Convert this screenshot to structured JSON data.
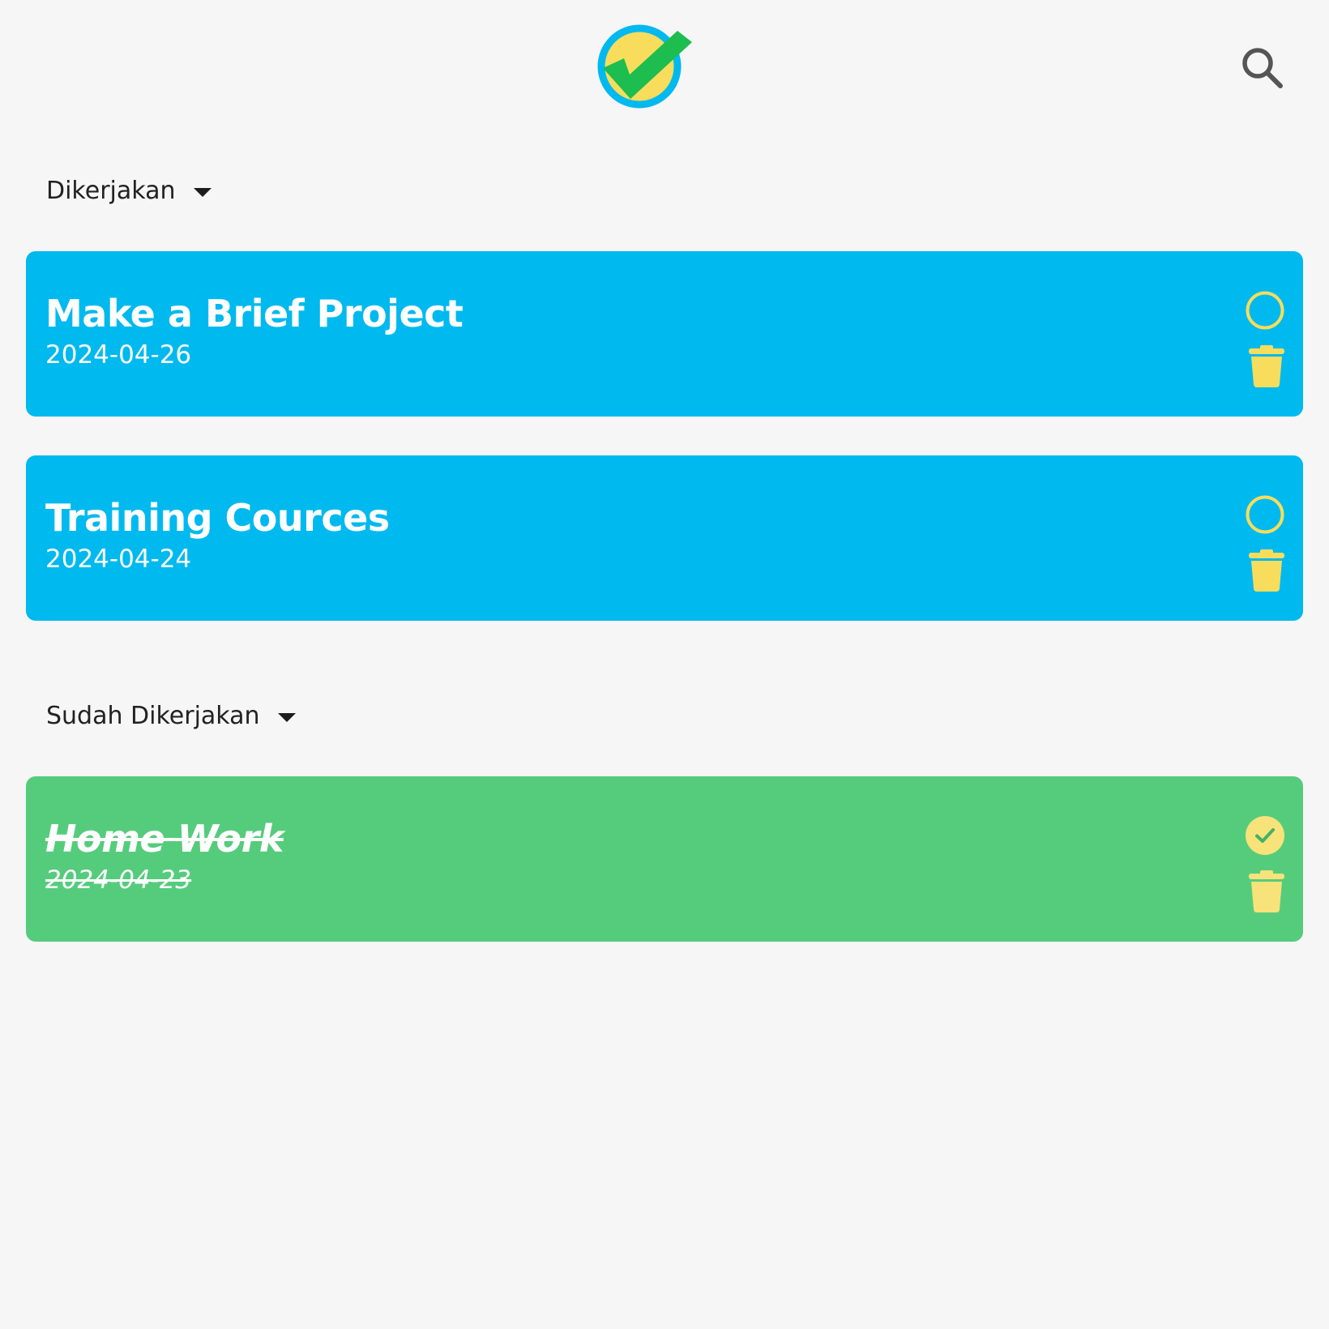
{
  "app": {
    "logo_icon": "check-badge-icon",
    "search_icon": "search-icon"
  },
  "colors": {
    "background": "#f6f6f6",
    "active_card": "#00b9ef",
    "done_card": "#55cc7c",
    "accent_yellow": "#f8dd5c",
    "logo_ring": "#00b9ef",
    "logo_check": "#1dbd50"
  },
  "sections": {
    "active": {
      "label": "Dikerjakan",
      "tasks": [
        {
          "title": "Make a Brief Project",
          "date": "2024-04-26",
          "done": false
        },
        {
          "title": "Training Cources",
          "date": "2024-04-24",
          "done": false
        }
      ]
    },
    "done": {
      "label": "Sudah Dikerjakan",
      "tasks": [
        {
          "title": "Home Work",
          "date": "2024-04-23",
          "done": true
        }
      ]
    }
  }
}
